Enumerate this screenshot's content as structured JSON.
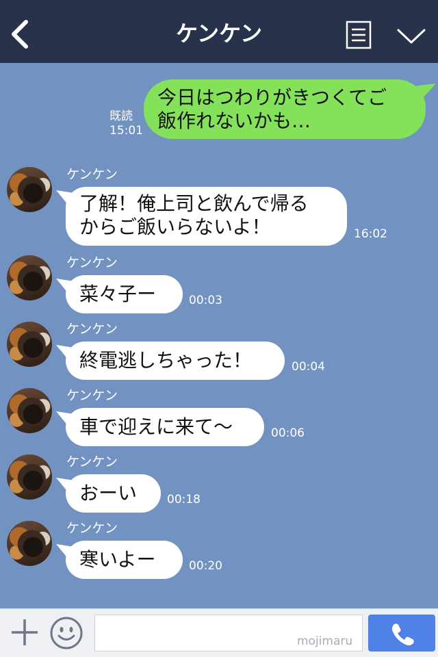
{
  "header": {
    "title": "ケンケン",
    "icons": {
      "back": "chevron-left-icon",
      "menu": "document-list-icon",
      "collapse": "chevron-down-icon"
    }
  },
  "sent_message": {
    "text": "今日はつわりがきつくてご飯作れないかも…",
    "line1": "今日はつわりがきつくてご",
    "line2": "飯作れないかも…",
    "status": "既読",
    "time": "15:01",
    "bubble_color": "#84e25a"
  },
  "received_messages": [
    {
      "sender": "ケンケン",
      "text": "了解！俺上司と飲んで帰るからご飯いらないよ！",
      "line1": "了解！俺上司と飲んで帰る",
      "line2": "からご飯いらないよ！",
      "time": "16:02"
    },
    {
      "sender": "ケンケン",
      "text": "菜々子ー",
      "time": "00:03"
    },
    {
      "sender": "ケンケン",
      "text": "終電逃しちゃった！",
      "time": "00:04"
    },
    {
      "sender": "ケンケン",
      "text": "車で迎えに来て〜",
      "time": "00:06"
    },
    {
      "sender": "ケンケン",
      "text": "おーい",
      "time": "00:18"
    },
    {
      "sender": "ケンケン",
      "text": "寒いよー",
      "time": "00:20"
    }
  ],
  "footer": {
    "input_value": "",
    "watermark": "mojimaru",
    "icons": {
      "add": "plus-icon",
      "emoji": "smiley-icon",
      "call": "phone-icon"
    }
  },
  "colors": {
    "header_bg": "#28324a",
    "chat_bg": "#7293c2",
    "call_button": "#4f81e6"
  }
}
